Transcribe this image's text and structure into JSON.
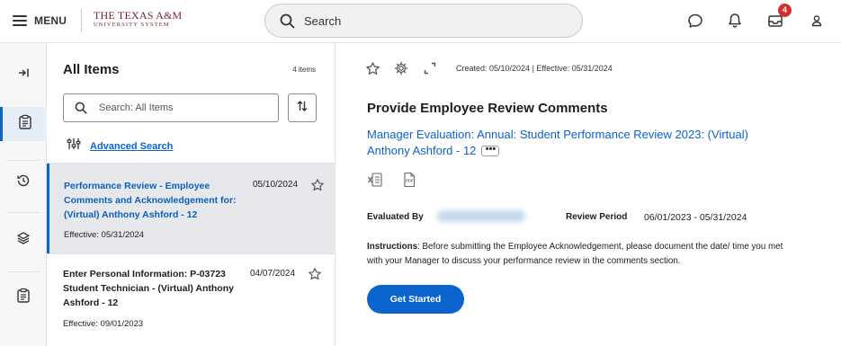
{
  "topbar": {
    "menu_label": "MENU",
    "logo_line1": "THE TEXAS A&M",
    "logo_line2": "UNIVERSITY SYSTEM",
    "search_placeholder": "Search",
    "inbox_badge": "4",
    "icons": [
      "menu-icon",
      "search-icon",
      "chat-icon",
      "bell-icon",
      "inbox-icon",
      "profile-icon"
    ]
  },
  "rail": {
    "items": [
      "collapse-icon",
      "clipboard-icon",
      "history-icon",
      "layers-icon",
      "clipboard-icon"
    ]
  },
  "list": {
    "title": "All Items",
    "count": "4 items",
    "search_placeholder": "Search: All Items",
    "advanced_search": "Advanced Search",
    "items": [
      {
        "title": "Performance Review - Employee Comments and Acknowledgement for: (Virtual) Anthony Ashford - 12",
        "date": "05/10/2024",
        "effective": "Effective: 05/31/2024"
      },
      {
        "title": "Enter Personal Information: P-03723 Student Technician - (Virtual) Anthony Ashford - 12",
        "date": "04/07/2024",
        "effective": "Effective: 09/01/2023"
      }
    ]
  },
  "detail": {
    "meta": "Created: 05/10/2024 | Effective: 05/31/2024",
    "title": "Provide Employee Review Comments",
    "link": "Manager Evaluation: Annual: Student Performance Review 2023: (Virtual) Anthony Ashford - 12",
    "more_label": "•••",
    "evaluated_by_label": "Evaluated By",
    "review_period_label": "Review Period",
    "review_period_value": "06/01/2023 - 05/31/2024",
    "instructions_label": "Instructions",
    "instructions_text": ": Before submitting the Employee Acknowledgement, please document the date/ time you met with your Manager to discuss your performance review in the comments section.",
    "button_label": "Get Started"
  },
  "colors": {
    "accent": "#0b63ce",
    "brand": "#7a1f2b",
    "badge": "#d32f2f"
  }
}
